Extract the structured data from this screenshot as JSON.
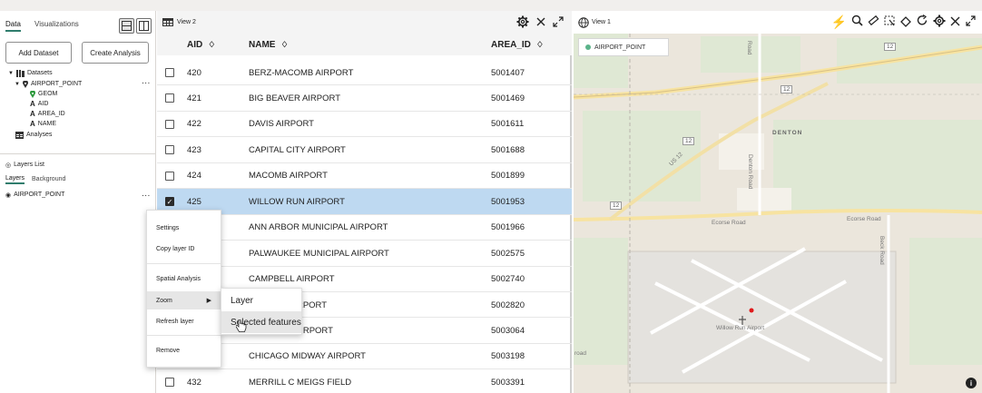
{
  "left_panel": {
    "tabs": [
      {
        "label": "Data",
        "active": true
      },
      {
        "label": "Visualizations",
        "active": false
      }
    ],
    "buttons": {
      "add_dataset": "Add Dataset",
      "create_analysis": "Create Analysis"
    },
    "tree": {
      "datasets_label": "Datasets",
      "dataset_name": "AIRPORT_POINT",
      "fields": [
        {
          "label": "GEOM",
          "icon": "pin-icon"
        },
        {
          "label": "AID",
          "icon": "text-attribute-icon"
        },
        {
          "label": "AREA_ID",
          "icon": "text-attribute-icon"
        },
        {
          "label": "NAME",
          "icon": "text-attribute-icon"
        }
      ],
      "analyses_label": "Analyses",
      "more": "..."
    },
    "layers_list": {
      "title": "Layers List",
      "tabs": [
        {
          "label": "Layers",
          "active": true
        },
        {
          "label": "Background",
          "active": false
        }
      ],
      "layer_name": "AIRPORT_POINT",
      "more": "..."
    }
  },
  "context_menu": {
    "items": [
      "Settings",
      "Copy layer ID",
      "Spatial Analysis",
      "Zoom",
      "Refresh layer",
      "Remove"
    ],
    "highlighted": "Zoom",
    "submenu": {
      "items": [
        "Layer",
        "Selected features"
      ],
      "highlighted": "Selected features"
    }
  },
  "table_view": {
    "title": "View 2",
    "columns": [
      "AID",
      "NAME",
      "AREA_ID"
    ],
    "sort_icon": "♢",
    "rows": [
      {
        "aid": "420",
        "name": "BERZ-MACOMB AIRPORT",
        "area_id": "5001407",
        "checked": false
      },
      {
        "aid": "421",
        "name": "BIG BEAVER AIRPORT",
        "area_id": "5001469",
        "checked": false
      },
      {
        "aid": "422",
        "name": "DAVIS AIRPORT",
        "area_id": "5001611",
        "checked": false
      },
      {
        "aid": "423",
        "name": "CAPITAL CITY AIRPORT",
        "area_id": "5001688",
        "checked": false
      },
      {
        "aid": "424",
        "name": "MACOMB AIRPORT",
        "area_id": "5001899",
        "checked": false
      },
      {
        "aid": "425",
        "name": "WILLOW RUN AIRPORT",
        "area_id": "5001953",
        "checked": true
      },
      {
        "aid": "",
        "name": "ANN ARBOR MUNICIPAL AIRPORT",
        "area_id": "5001966",
        "checked": false
      },
      {
        "aid": "",
        "name": "PALWAUKEE MUNICIPAL AIRPORT",
        "area_id": "5002575",
        "checked": false
      },
      {
        "aid": "",
        "name": "CAMPBELL AIRPORT",
        "area_id": "5002740",
        "checked": false
      },
      {
        "aid": "",
        "name": "EGIONAL AIRPORT",
        "area_id": "5002820",
        "checked": false
      },
      {
        "aid": "",
        "name": "REGIONAL AIRPORT",
        "area_id": "5003064",
        "checked": false
      },
      {
        "aid": "",
        "name": "CHICAGO MIDWAY AIRPORT",
        "area_id": "5003198",
        "checked": false
      },
      {
        "aid": "432",
        "name": "MERRILL C MEIGS FIELD",
        "area_id": "5003391",
        "checked": false
      }
    ]
  },
  "map_view": {
    "title": "View 1",
    "legend_label": "AIRPORT_POINT",
    "labels": {
      "denton": "DENTON",
      "denton_road": "Denton Road",
      "ecorse_road_1": "Ecorse Road",
      "ecorse_road_2": "Ecorse Road",
      "beck_road": "Beck Road",
      "willow_run": "Willow Run Airport",
      "us12": "US 12",
      "shield_12a": "12",
      "shield_12b": "12",
      "shield_12c": "12",
      "shield_12d": "12",
      "road_corner": "road",
      "road_top": "Road"
    },
    "info_label": "i",
    "colors": {
      "map_bg": "#ebe6dc",
      "park_green": "#dfe8d4",
      "major_road": "#f7e3a1",
      "selected_point": "#e0191b"
    }
  },
  "colors": {
    "selected_row": "#bed9f1",
    "accent": "#2f7d6d"
  }
}
